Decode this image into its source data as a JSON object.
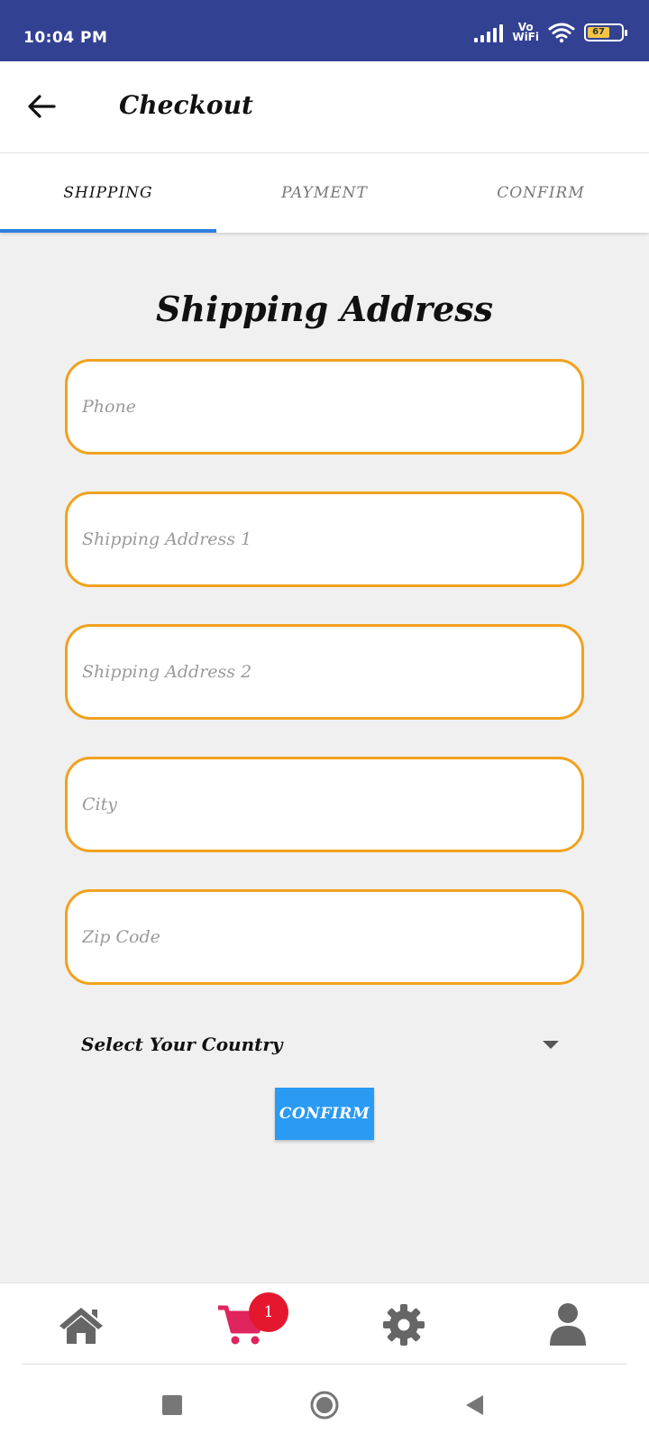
{
  "status_bar": {
    "time": "10:04 PM",
    "network_label_top": "Vo",
    "network_label_bottom": "WiFi",
    "battery_level": "67",
    "battery_fraction": 0.67
  },
  "app_bar": {
    "title": "Checkout",
    "back_icon": "arrow-left-icon"
  },
  "tabs": [
    {
      "label": "SHIPPING",
      "active": true
    },
    {
      "label": "PAYMENT",
      "active": false
    },
    {
      "label": "CONFIRM",
      "active": false
    }
  ],
  "form": {
    "title": "Shipping Address",
    "fields": [
      {
        "placeholder": "Phone",
        "value": ""
      },
      {
        "placeholder": "Shipping Address 1",
        "value": ""
      },
      {
        "placeholder": "Shipping Address 2",
        "value": ""
      },
      {
        "placeholder": "City",
        "value": ""
      },
      {
        "placeholder": "Zip Code",
        "value": ""
      }
    ],
    "country_select_label": "Select Your Country",
    "confirm_label": "CONFIRM"
  },
  "bottom_nav": {
    "items": [
      {
        "icon": "home-icon"
      },
      {
        "icon": "cart-icon",
        "badge": "1"
      },
      {
        "icon": "gear-icon"
      },
      {
        "icon": "user-icon"
      }
    ]
  },
  "colors": {
    "status_bar": "#334193",
    "tab_indicator": "#2f7ee0",
    "field_border": "#f0a21f",
    "confirm_button": "#2a9af3",
    "cart_icon": "#e0245e",
    "badge": "#e5172f"
  }
}
